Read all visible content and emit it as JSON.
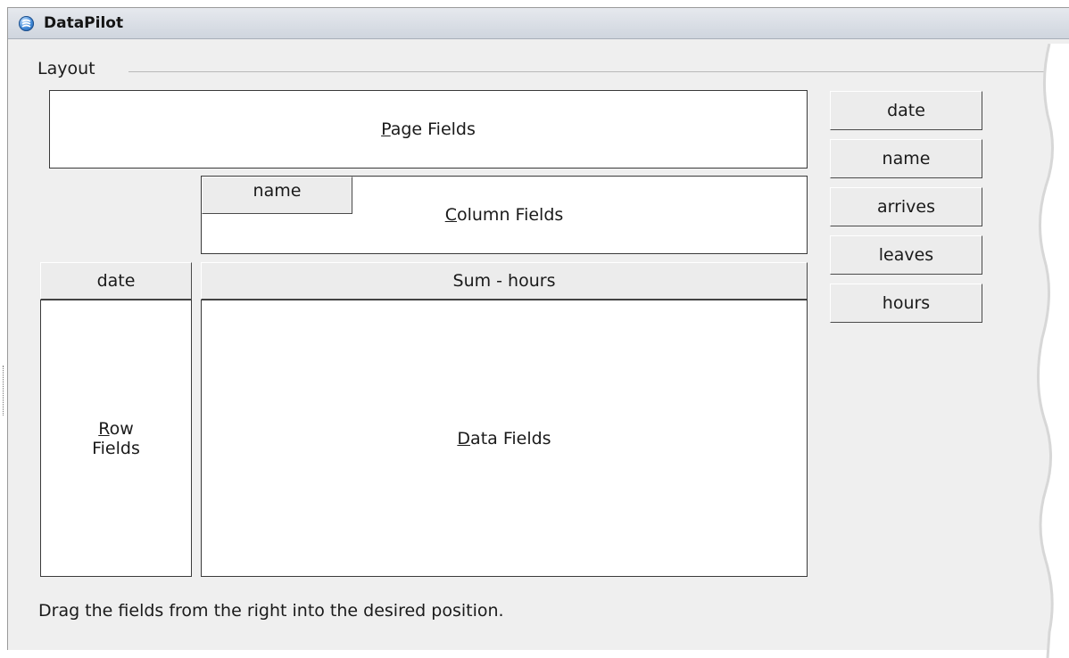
{
  "window": {
    "title": "DataPilot"
  },
  "layout_group": {
    "label": "Layout"
  },
  "areas": {
    "page": {
      "underline": "P",
      "rest": "age Fields"
    },
    "column": {
      "underline": "C",
      "rest": "olumn Fields"
    },
    "row": {
      "underline": "R",
      "rest_line1": "ow",
      "line2": "Fields"
    },
    "data": {
      "underline": "D",
      "rest": "ata Fields"
    }
  },
  "placed_fields": {
    "column": "name",
    "row": "date",
    "data": "Sum - hours"
  },
  "available_fields": [
    "date",
    "name",
    "arrives",
    "leaves",
    "hours"
  ],
  "hint": "Drag the fields from the right into the desired position."
}
